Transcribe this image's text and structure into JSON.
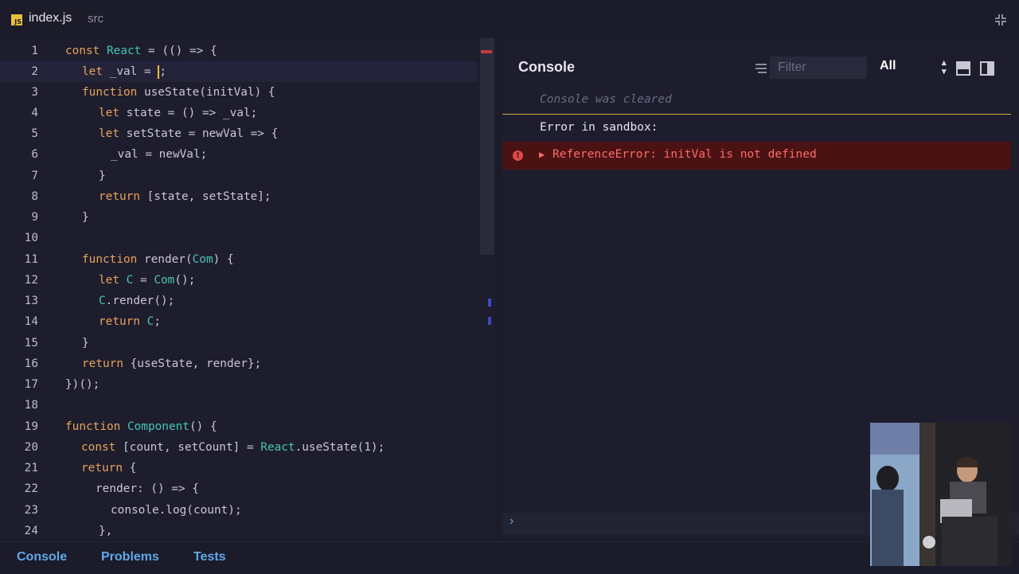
{
  "tab": {
    "file_badge": "JS",
    "file_name": "index.js",
    "folder": "src",
    "collapse_icon": "collapse-icon"
  },
  "editor": {
    "lines": [
      {
        "n": "1"
      },
      {
        "n": "2"
      },
      {
        "n": "3"
      },
      {
        "n": "4"
      },
      {
        "n": "5"
      },
      {
        "n": "6"
      },
      {
        "n": "7"
      },
      {
        "n": "8"
      },
      {
        "n": "9"
      },
      {
        "n": "10"
      },
      {
        "n": "11"
      },
      {
        "n": "12"
      },
      {
        "n": "13"
      },
      {
        "n": "14"
      },
      {
        "n": "15"
      },
      {
        "n": "16"
      },
      {
        "n": "17"
      },
      {
        "n": "18"
      },
      {
        "n": "19"
      },
      {
        "n": "20"
      },
      {
        "n": "21"
      },
      {
        "n": "22"
      },
      {
        "n": "23"
      },
      {
        "n": "24"
      }
    ],
    "code": {
      "l1_kw": "const",
      "l1_name": "React",
      "l1_rest": " = (() => {",
      "l2_kw": "let",
      "l2_rest": " _val = ",
      "l2_after": ";",
      "l3_kw": "function",
      "l3_rest": " useState(initVal) {",
      "l4_kw": "let",
      "l4_rest": " state = () => _val;",
      "l5_kw": "let",
      "l5_rest": " setState = newVal => {",
      "l6": "_val = newVal;",
      "l7": "}",
      "l8_kw": "return",
      "l8_rest": " [state, setState];",
      "l9": "}",
      "l11_kw": "function",
      "l11_mid": " render(",
      "l11_ty": "Com",
      "l11_rest": ") {",
      "l12_kw": "let",
      "l12_c": " C",
      "l12_mid": " = ",
      "l12_ty": "Com",
      "l12_rest": "();",
      "l13_ty": "C",
      "l13_rest": ".render();",
      "l14_kw": "return",
      "l14_ty": " C",
      "l14_rest": ";",
      "l15": "}",
      "l16_kw": "return",
      "l16_rest": " {useState, render};",
      "l17": "})();",
      "l19_kw": "function",
      "l19_ty": " Component",
      "l19_rest": "() {",
      "l20_kw": "const",
      "l20_mid": " [count, setCount] = ",
      "l20_ty": "React",
      "l20_rest": ".useState(1);",
      "l21_kw": "return",
      "l21_rest": " {",
      "l22": "render: () => {",
      "l23": "console.log(count);",
      "l24": "},"
    }
  },
  "console": {
    "title": "Console",
    "filter_placeholder": "Filter",
    "level": "All",
    "cleared": "Console was cleared",
    "error_heading": "Error in sandbox:",
    "error_message": "ReferenceError: initVal is not defined",
    "prompt": "›"
  },
  "bottom_tabs": {
    "console": "Console",
    "problems": "Problems",
    "tests": "Tests"
  },
  "colors": {
    "keyword": "#e7a35a",
    "type": "#47c6b4",
    "error_bg": "#4a1212",
    "error_text": "#ff6b6b",
    "tab_accent": "#5fa8e8"
  }
}
